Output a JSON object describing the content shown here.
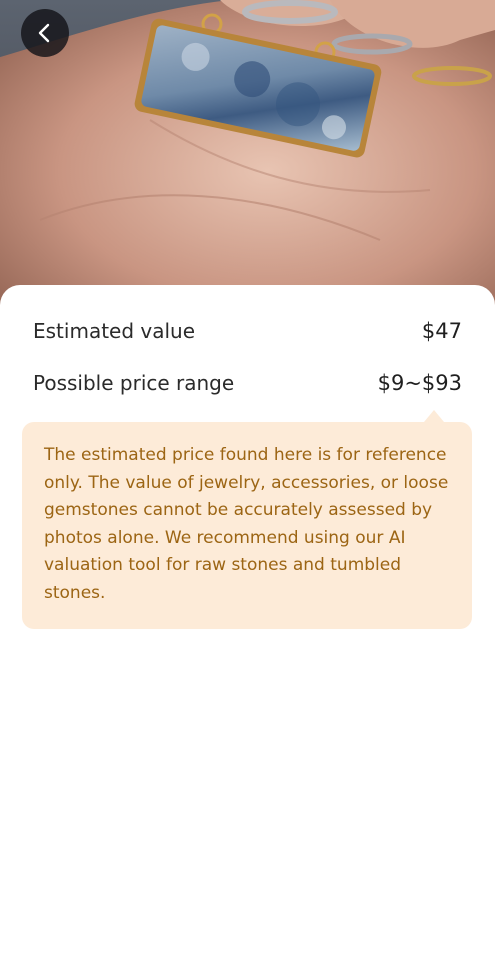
{
  "header": {
    "back_icon": "chevron-left-icon"
  },
  "photo": {
    "subject": "gemstone-pendant-photo"
  },
  "valuation": {
    "estimated_label": "Estimated value",
    "estimated_value": "$47",
    "range_label": "Possible price range",
    "range_value": "$9~$93"
  },
  "notice": {
    "text": "The estimated price found here is for reference only. The value of jewelry, accessories, or loose gemstones cannot be accurately assessed by photos alone. We recommend using our AI valuation tool for raw stones and tumbled stones."
  },
  "colors": {
    "notice_background": "#fdebd8",
    "notice_text": "#9c6514",
    "back_button": "#141418"
  }
}
